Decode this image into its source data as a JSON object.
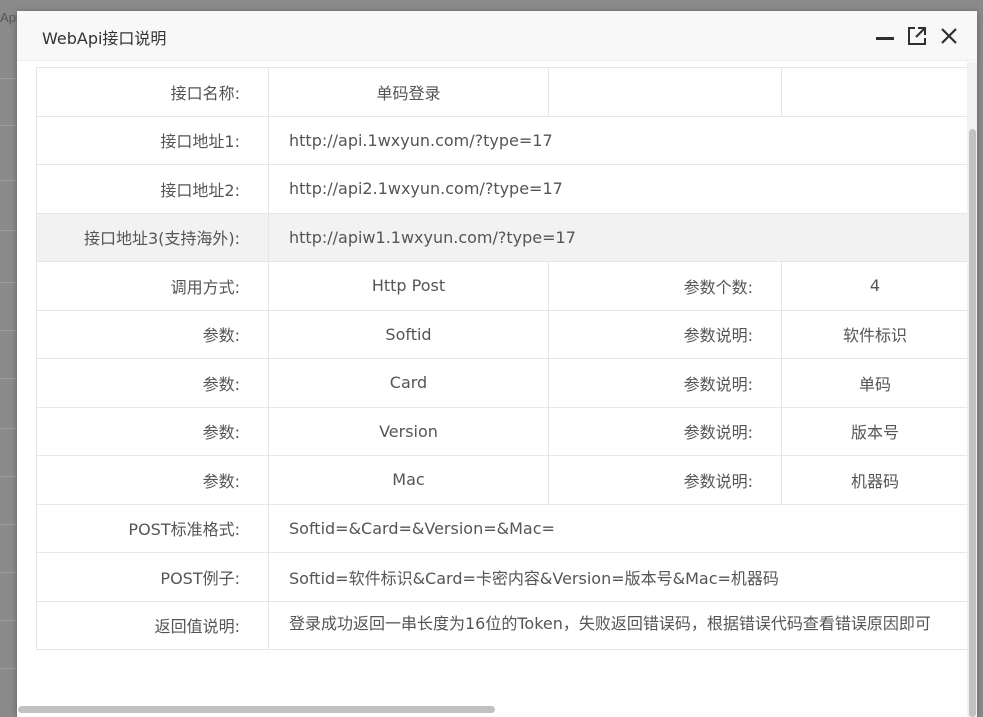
{
  "background": {
    "partial_text": "Api"
  },
  "dialog": {
    "title": "WebApi接口说明",
    "controls": {
      "minimize_icon": "minimize-icon",
      "maximize_icon": "maximize-icon",
      "close_icon": "close-icon"
    }
  },
  "table": {
    "name_label": "接口名称:",
    "name_value": "单码登录",
    "url1_label": "接口地址1:",
    "url1_value": "http://api.1wxyun.com/?type=17",
    "url2_label": "接口地址2:",
    "url2_value": "http://api2.1wxyun.com/?type=17",
    "url3_label": "接口地址3(支持海外):",
    "url3_value": "http://apiw1.1wxyun.com/?type=17",
    "method_label": "调用方式:",
    "method_value": "Http Post",
    "param_count_label": "参数个数:",
    "param_count_value": "4",
    "params": [
      {
        "label": "参数:",
        "name": "Softid",
        "desc_label": "参数说明:",
        "desc": "软件标识"
      },
      {
        "label": "参数:",
        "name": "Card",
        "desc_label": "参数说明:",
        "desc": "单码"
      },
      {
        "label": "参数:",
        "name": "Version",
        "desc_label": "参数说明:",
        "desc": "版本号"
      },
      {
        "label": "参数:",
        "name": "Mac",
        "desc_label": "参数说明:",
        "desc": "机器码"
      }
    ],
    "post_format_label": "POST标准格式:",
    "post_format_value": "Softid=&Card=&Version=&Mac=",
    "post_example_label": "POST例子:",
    "post_example_value": "Softid=软件标识&Card=卡密内容&Version=版本号&Mac=机器码",
    "return_label": "返回值说明:",
    "return_value": "登录成功返回一串长度为16位的Token，失败返回错误码，根据错误代码查看错误原因即可"
  },
  "colors": {
    "highlight_row": "#f2f2f2",
    "border": "#e6e6e6",
    "text": "#555555"
  }
}
